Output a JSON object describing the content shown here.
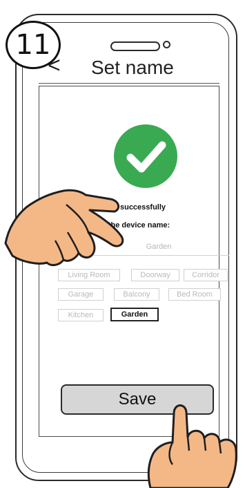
{
  "step_number": "11",
  "header": {
    "back_glyph": "<",
    "title": "Set name"
  },
  "messages": {
    "success": "Device added successfully",
    "prompt": "Please set the device name:"
  },
  "name_input": {
    "value": "",
    "placeholder": "Garden"
  },
  "chips": [
    {
      "label": "Living Room",
      "selected": false
    },
    {
      "label": "Doorway",
      "selected": false
    },
    {
      "label": "Corridor",
      "selected": false
    },
    {
      "label": "Garage",
      "selected": false
    },
    {
      "label": "Balcony",
      "selected": false
    },
    {
      "label": "Bed Room",
      "selected": false
    },
    {
      "label": "Kitchen",
      "selected": false
    },
    {
      "label": "Garden",
      "selected": true
    }
  ],
  "save_label": "Save",
  "colors": {
    "success_green": "#3aaa52",
    "hand_fill": "#f4b887",
    "button_fill": "#d6d6d6"
  },
  "icons": [
    "check-circle-icon",
    "pointing-hand-icon",
    "tapping-hand-icon"
  ]
}
